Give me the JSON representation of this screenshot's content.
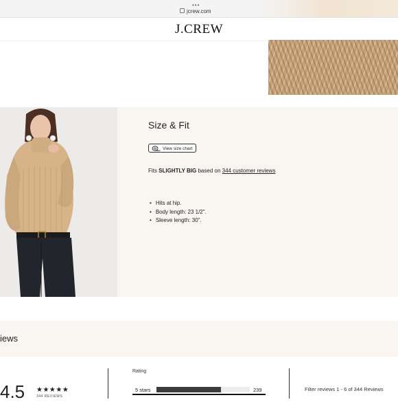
{
  "browser": {
    "dots": "•••",
    "url": "jcrew.com"
  },
  "header": {
    "logo": "J.CREW"
  },
  "size_fit": {
    "title": "Size & Fit",
    "size_chart_button": "View size chart",
    "fit_prefix": "Fits",
    "fit_value": "SLIGHTLY BIG",
    "fit_middle": "based on",
    "fit_link": "344 customer reviews",
    "bullets": [
      "Hits at hip.",
      "Body length: 23 1/2\".",
      "Sleeve length: 30\"."
    ]
  },
  "reviews": {
    "title": "iews",
    "score": "4.5",
    "stars": "★★★★★",
    "count_label": "344 REVIEWS",
    "rating_label": "Rating",
    "breakdown": [
      {
        "label": "5 stars",
        "count": "239",
        "fraction": 0.69
      }
    ],
    "filter_text": "Filter reviews 1 - 6 of 344 Reviews"
  },
  "colors": {
    "section_bg": "#f9f6f2",
    "bar_fill": "#3c3c3c",
    "sweater": "#d6b488"
  }
}
